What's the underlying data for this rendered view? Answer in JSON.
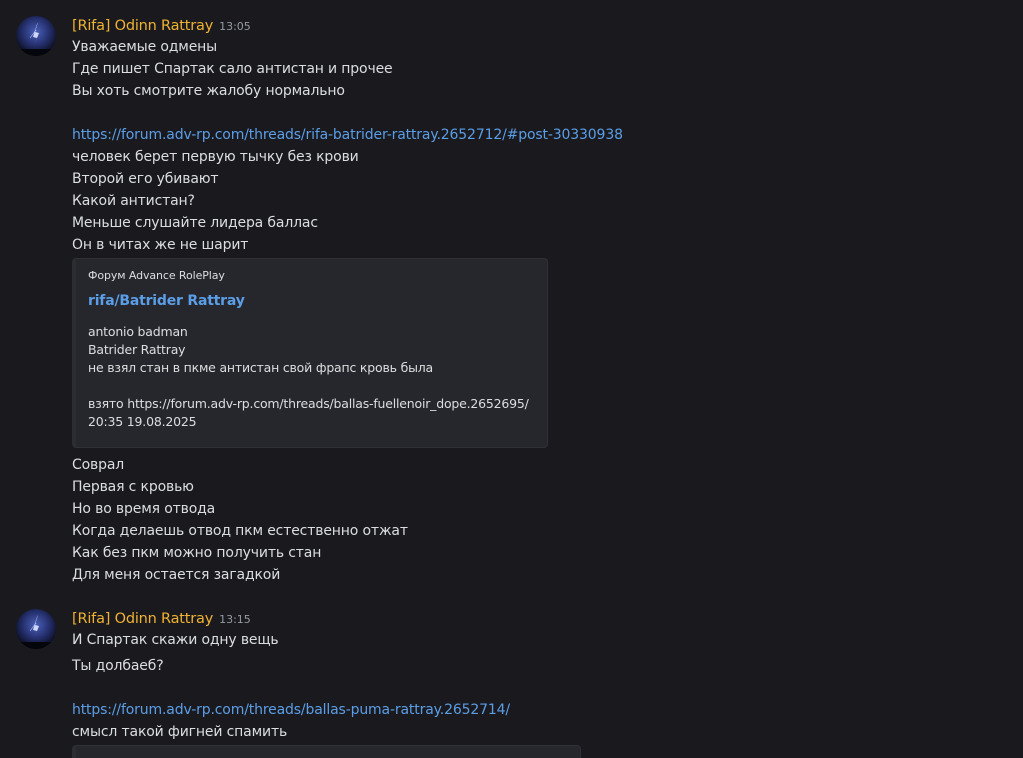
{
  "messages": [
    {
      "author": "[Rifa] Odinn Rattray",
      "time": "13:05",
      "lines": [
        "Уважаемые одмены",
        "Где пишет Спартак сало антистан и прочее",
        "Вы хоть смотрите жалобу нормально"
      ],
      "link": "https://forum.adv-rp.com/threads/rifa-batrider-rattray.2652712/#post-30330938",
      "lines_after_link": [
        "человек берет первую тычку без крови",
        "Второй его убивают",
        "Какой антистан?",
        "Меньше слушайте лидера баллас",
        "Он в читах же не шарит"
      ],
      "embed": {
        "provider": "Форум Advance RolePlay",
        "title": "rifa/Batrider Rattray",
        "description": [
          "antonio badman",
          "Batrider Rattray",
          "не взял стан в пкме антистан свой фрапс кровь была",
          "",
          "взято https://forum.adv-rp.com/threads/ballas-fuellenoir_dope.2652695/",
          "20:35 19.08.2025"
        ]
      },
      "lines_after_embed": [
        "Соврал",
        "Первая с кровью",
        "Но во время отвода",
        "Когда делаешь отвод пкм естественно отжат",
        "Как без пкм можно получить стан",
        "Для меня остается загадкой"
      ]
    },
    {
      "author": "[Rifa] Odinn Rattray",
      "time": "13:15",
      "lines": [
        "И Спартак скажи одну вещь",
        "Ты долбаеб?"
      ],
      "link": "https://forum.adv-rp.com/threads/ballas-puma-rattray.2652714/",
      "lines_after_link": [
        "смысл такой фигней спамить"
      ]
    }
  ],
  "colors": {
    "background": "#1a1a1e",
    "username": "#f0b232",
    "link": "#5b9ee8",
    "text": "#dbdee1",
    "timestamp": "#949ba4"
  }
}
